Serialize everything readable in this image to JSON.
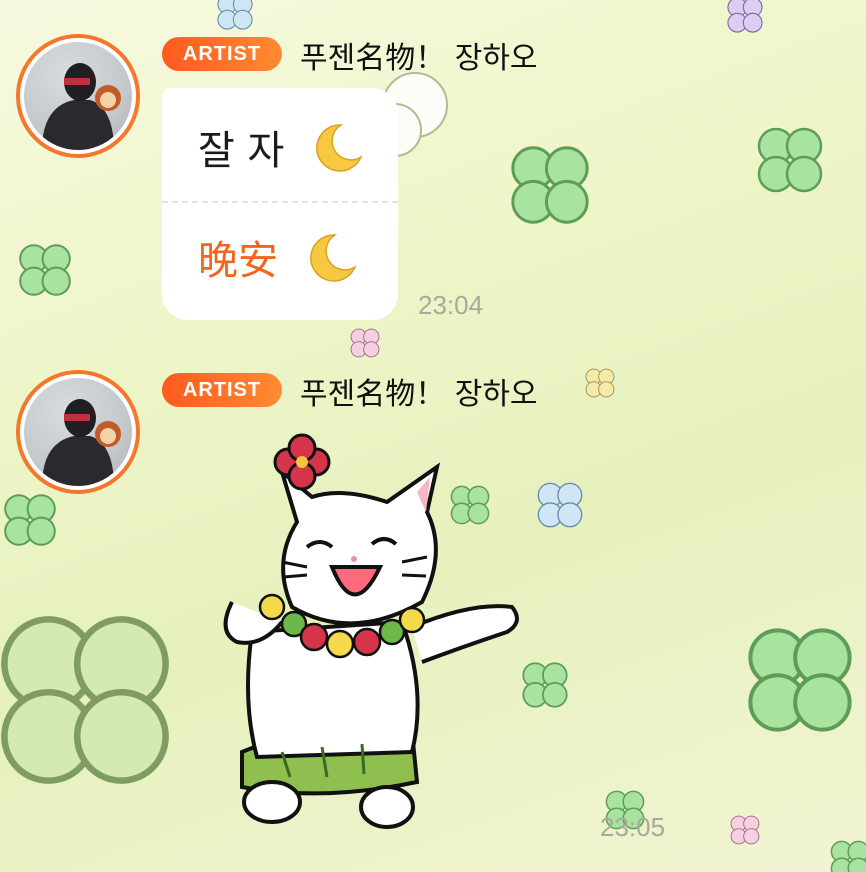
{
  "messages": [
    {
      "badge": "ARTIST",
      "sender": "푸젠名物！ 장하오",
      "lines": [
        "잘 자",
        "晚安"
      ],
      "line_icons": [
        "crescent-moon-icon",
        "crescent-moon-icon"
      ],
      "timestamp": "23:04"
    },
    {
      "badge": "ARTIST",
      "sender": "푸젠名物！ 장하오",
      "sticker": "dancing-cat-sticker",
      "timestamp": "23:05"
    }
  ],
  "colors": {
    "badge_start": "#ff5a1f",
    "badge_end": "#ff8b32",
    "avatar_ring": "#f4772c",
    "chinese_text": "#f4641c",
    "timestamp": "#a7a99a",
    "background": "#eef5c8"
  }
}
